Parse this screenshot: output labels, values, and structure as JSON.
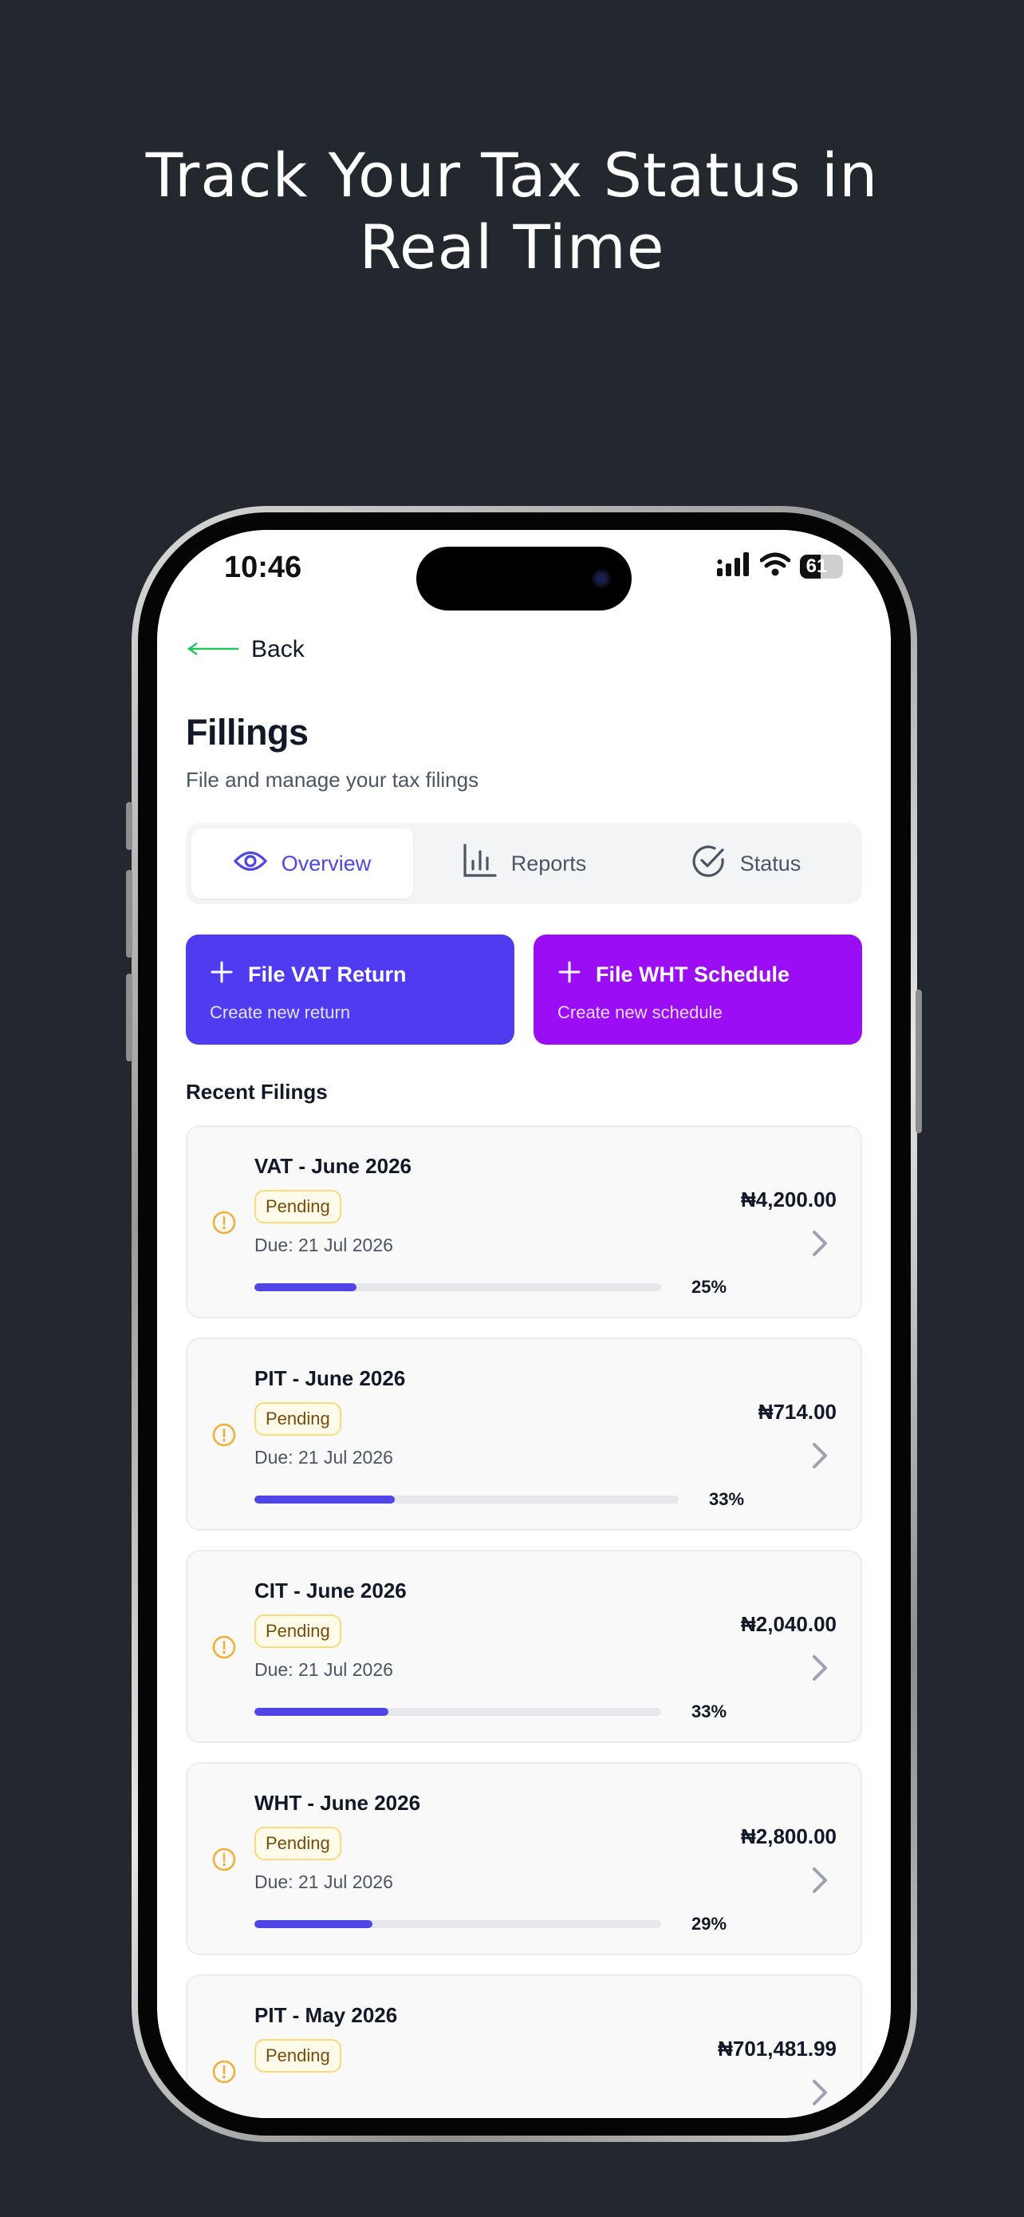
{
  "headline": {
    "line1": "Track Your Tax Status in",
    "line2": "Real Time"
  },
  "status_bar": {
    "time": "10:46",
    "battery": "61",
    "battery_level": 0.61,
    "icons": [
      "signal-icon",
      "wifi-icon",
      "battery-icon"
    ]
  },
  "nav": {
    "back_label": "Back"
  },
  "page": {
    "title": "Fillings",
    "subtitle": "File and manage your tax filings"
  },
  "tabs": [
    {
      "label": "Overview",
      "icon": "eye-icon",
      "active": true
    },
    {
      "label": "Reports",
      "icon": "bar-chart-icon",
      "active": false
    },
    {
      "label": "Status",
      "icon": "check-circle-icon",
      "active": false
    }
  ],
  "actions": [
    {
      "title": "File VAT Return",
      "subtitle": "Create new return",
      "color": "#4f3cf0"
    },
    {
      "title": "File WHT Schedule",
      "subtitle": "Create new schedule",
      "color": "#9a0df5"
    }
  ],
  "recent": {
    "title": "Recent Filings",
    "items": [
      {
        "title": "VAT - June 2026",
        "status": "Pending",
        "due": "Due: 21 Jul 2026",
        "progress": 25,
        "progress_label": "25%",
        "amount": "₦4,200.00"
      },
      {
        "title": "PIT - June 2026",
        "status": "Pending",
        "due": "Due: 21 Jul 2026",
        "progress": 33,
        "progress_label": "33%",
        "amount": "₦714.00"
      },
      {
        "title": "CIT - June 2026",
        "status": "Pending",
        "due": "Due: 21 Jul 2026",
        "progress": 33,
        "progress_label": "33%",
        "amount": "₦2,040.00"
      },
      {
        "title": "WHT - June 2026",
        "status": "Pending",
        "due": "Due: 21 Jul 2026",
        "progress": 29,
        "progress_label": "29%",
        "amount": "₦2,800.00"
      },
      {
        "title": "PIT - May 2026",
        "status": "Pending",
        "due": "",
        "progress": 0,
        "progress_label": "",
        "amount": "₦701,481.99"
      }
    ]
  },
  "colors": {
    "background": "#23272e",
    "accent": "#4f46e5",
    "pending": "#f0b13a"
  }
}
